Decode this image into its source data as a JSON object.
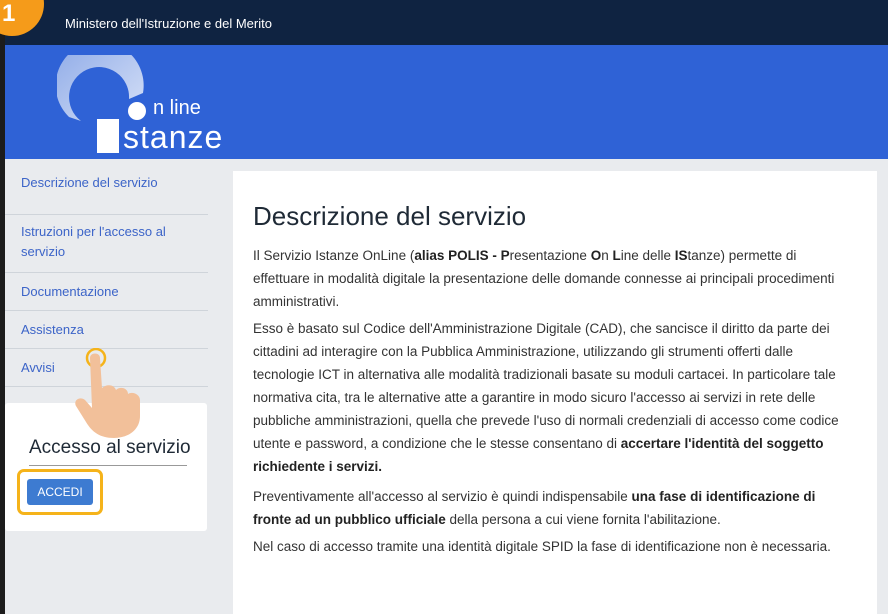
{
  "step_badge": "1",
  "topbar": {
    "title": "Ministero dell'Istruzione e del Merito"
  },
  "logo": {
    "line_text": "n line",
    "stanze_text": "stanze"
  },
  "sidebar": {
    "items": [
      {
        "label": "Descrizione del servizio"
      },
      {
        "label": "Istruzioni per l'accesso al servizio"
      },
      {
        "label": "Documentazione"
      },
      {
        "label": "Assistenza"
      },
      {
        "label": "Avvisi"
      }
    ],
    "access_title": "Accesso al servizio",
    "accedi_label": "ACCEDI"
  },
  "content": {
    "heading": "Descrizione del servizio",
    "p1": [
      "Il Servizio Istanze OnLine (",
      "alias POLIS - P",
      "resentazione ",
      "O",
      "n ",
      "L",
      "ine delle ",
      "IS",
      "tanze) permette di effettuare in modalità digitale la presentazione delle domande connesse ai principali procedimenti amministrativi."
    ],
    "p2_plain": "Esso è basato sul Codice dell'Amministrazione Digitale (CAD), che sancisce il diritto da parte dei cittadini ad interagire con la Pubblica Amministrazione, utilizzando gli strumenti offerti dalle tecnologie ICT in alternativa alle modalità tradizionali basate su moduli cartacei. In particolare tale normativa cita, tra le alternative atte a garantire in modo sicuro l'accesso ai servizi in rete delle pubbliche amministrazioni, quella che prevede l'uso di normali credenziali di accesso come codice utente e password, a condizione che le stesse consentano di ",
    "p2_bold": "accertare l'identità del soggetto richiedente i servizi.",
    "p3_plain": "Preventivamente all'accesso al servizio è quindi indispensabile ",
    "p3_bold": "una fase di identificazione di fronte ad un pubblico ufficiale",
    "p3_end": " della persona a cui viene fornita l'abilitazione.",
    "p4": "Nel caso di accesso tramite una identità digitale SPID la fase di identificazione non è necessaria."
  }
}
